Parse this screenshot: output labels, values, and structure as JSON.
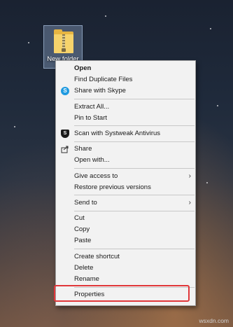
{
  "desktop": {
    "icon_label": "New folder"
  },
  "context_menu": {
    "groups": [
      [
        {
          "label": "Open",
          "bold": true
        },
        {
          "label": "Find Duplicate Files"
        },
        {
          "label": "Share with Skype",
          "icon": "skype-icon"
        }
      ],
      [
        {
          "label": "Extract All..."
        },
        {
          "label": "Pin to Start"
        }
      ],
      [
        {
          "label": "Scan with Systweak Antivirus",
          "icon": "shield-icon"
        }
      ],
      [
        {
          "label": "Share",
          "icon": "share-icon"
        },
        {
          "label": "Open with..."
        }
      ],
      [
        {
          "label": "Give access to",
          "submenu": true
        },
        {
          "label": "Restore previous versions"
        }
      ],
      [
        {
          "label": "Send to",
          "submenu": true
        }
      ],
      [
        {
          "label": "Cut"
        },
        {
          "label": "Copy"
        },
        {
          "label": "Paste"
        }
      ],
      [
        {
          "label": "Create shortcut"
        },
        {
          "label": "Delete"
        },
        {
          "label": "Rename"
        }
      ],
      [
        {
          "label": "Properties"
        }
      ]
    ]
  },
  "highlight_color": "#e0373a",
  "watermark": "wsxdn.com"
}
